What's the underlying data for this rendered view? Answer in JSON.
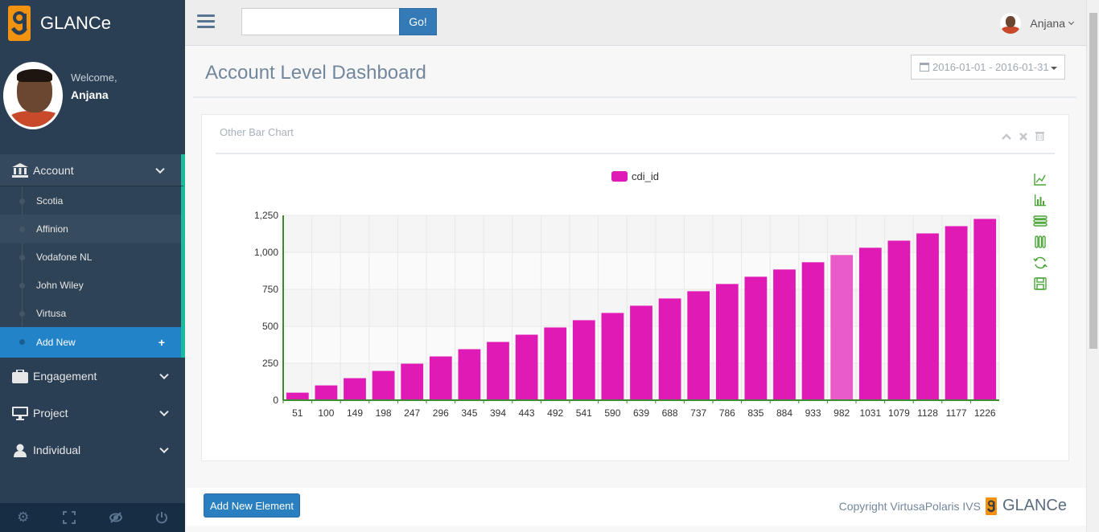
{
  "app": {
    "brand": "GLANCe"
  },
  "profile": {
    "welcome": "Welcome,",
    "name": "Anjana"
  },
  "sidebar": {
    "account_label": "Account",
    "account_items": [
      {
        "label": "Scotia"
      },
      {
        "label": "Affinion"
      },
      {
        "label": "Vodafone NL"
      },
      {
        "label": "John Wiley"
      },
      {
        "label": "Virtusa"
      },
      {
        "label": "Add New",
        "suffix": "+"
      }
    ],
    "sections": [
      {
        "label": "Engagement",
        "icon": "briefcase-icon"
      },
      {
        "label": "Project",
        "icon": "desktop-icon"
      },
      {
        "label": "Individual",
        "icon": "user-icon"
      }
    ],
    "footer_icons": [
      "settings-icon",
      "fullscreen-icon",
      "lock-icon",
      "logout-icon"
    ]
  },
  "topnav": {
    "search_placeholder": "",
    "go_label": "Go!",
    "user_name": "Anjana"
  },
  "page": {
    "title": "Account Level Dashboard",
    "date_range": "2016-01-01 - 2016-01-31"
  },
  "panel": {
    "title": "Other Bar Chart",
    "tools": [
      "collapse-icon",
      "close-icon",
      "trash-icon"
    ],
    "toolbox": [
      "line-chart-icon",
      "bar-chart-icon",
      "stack-icon",
      "tiled-icon",
      "restore-icon",
      "save-image-icon"
    ]
  },
  "chart_data": {
    "type": "bar",
    "categories": [
      "51",
      "100",
      "149",
      "198",
      "247",
      "296",
      "345",
      "394",
      "443",
      "492",
      "541",
      "590",
      "639",
      "688",
      "737",
      "786",
      "835",
      "884",
      "933",
      "982",
      "1031",
      "1079",
      "1128",
      "1177",
      "1226"
    ],
    "series": [
      {
        "name": "cdi_id",
        "values": [
          51,
          100,
          149,
          198,
          247,
          296,
          345,
          394,
          443,
          492,
          541,
          590,
          639,
          688,
          737,
          786,
          835,
          884,
          933,
          982,
          1031,
          1079,
          1128,
          1177,
          1226
        ]
      }
    ],
    "ylim": [
      0,
      1250
    ],
    "yticks": [
      "0",
      "250",
      "500",
      "750",
      "1,000",
      "1,250"
    ],
    "grid": true,
    "legend": "top-center",
    "highlight_index": 19,
    "colors": {
      "bar": "#e01ab5",
      "highlight": "#e85bc9",
      "axis": "#3c8b2f"
    }
  },
  "footer": {
    "add_button": "Add New Element",
    "copyright": "Copyright VirtusaPolaris IVS",
    "brand": "GLANCe"
  }
}
